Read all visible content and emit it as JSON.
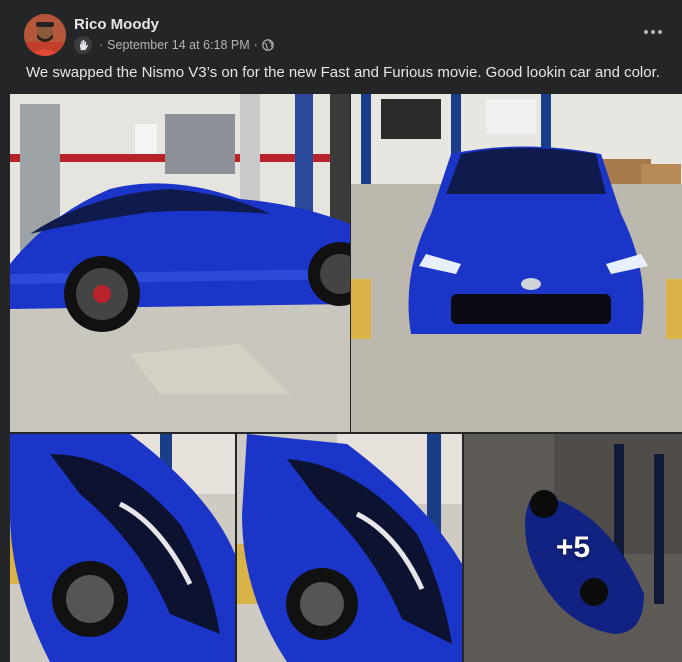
{
  "post": {
    "author": "Rico Moody",
    "date": "September 14 at 6:18 PM",
    "separator": "·",
    "caption": "We swapped the Nismo V3’s on for the new Fast and Furious movie. Good lookin car and color.",
    "privacy_icon": "globe-icon",
    "app_icon": "waving-hand-icon",
    "more_icon": "more-options-icon"
  },
  "photos": {
    "count": 5,
    "extra_count_label": "+5",
    "car_color": "#1b35c9",
    "items": [
      {
        "name": "car-side-profile"
      },
      {
        "name": "car-front-view"
      },
      {
        "name": "car-rear-quarter-1"
      },
      {
        "name": "car-rear-quarter-2"
      },
      {
        "name": "car-overhead"
      }
    ]
  },
  "colors": {
    "background": "#242526",
    "text_primary": "#e4e6eb",
    "text_secondary": "#b0b3b8"
  }
}
